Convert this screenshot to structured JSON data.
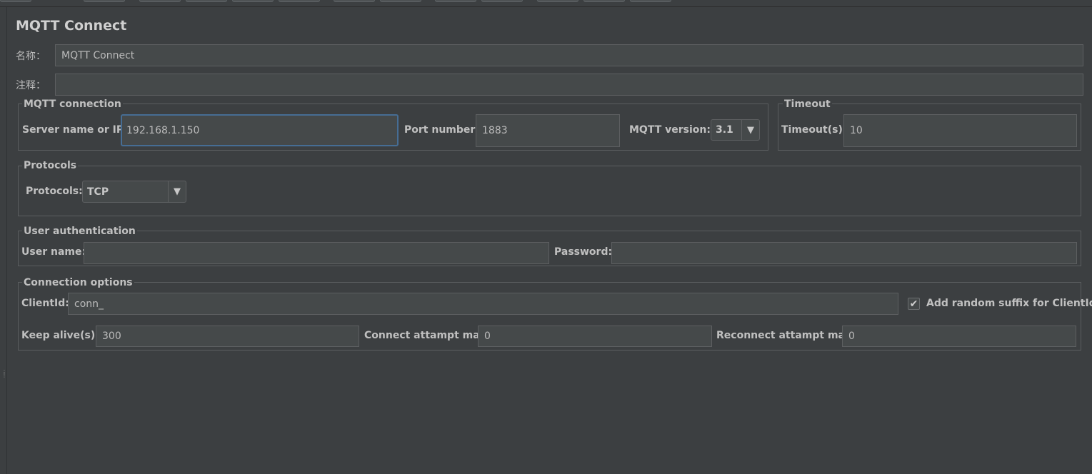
{
  "title": "MQTT Connect",
  "name_row": {
    "label": "名称：",
    "value": "MQTT Connect"
  },
  "comment_row": {
    "label": "注释：",
    "value": ""
  },
  "mqtt_connection": {
    "legend": "MQTT connection",
    "server_label": "Server name or IP:",
    "server_value": "192.168.1.150",
    "port_label": "Port number:",
    "port_value": "1883",
    "version_label": "MQTT version:",
    "version_value": "3.1"
  },
  "timeout": {
    "legend": "Timeout",
    "label": "Timeout(s):",
    "value": "10"
  },
  "protocols": {
    "legend": "Protocols",
    "label": "Protocols:",
    "value": "TCP"
  },
  "user_auth": {
    "legend": "User authentication",
    "user_label": "User name:",
    "user_value": "",
    "password_label": "Password:",
    "password_value": ""
  },
  "connection_options": {
    "legend": "Connection options",
    "clientid_label": "ClientId:",
    "clientid_value": "conn_",
    "random_suffix_label": "Add random suffix for ClientId",
    "random_suffix_checked": true,
    "keepalive_label": "Keep alive(s):",
    "keepalive_value": "300",
    "connect_max_label": "Connect attampt max:",
    "connect_max_value": "0",
    "reconnect_max_label": "Reconnect attampt max:",
    "reconnect_max_value": "0"
  },
  "icons": {
    "dropdown_arrow": "chevron-down-icon",
    "check": "checkmark-icon",
    "splitter": "splitter-grip-icon"
  },
  "colors": {
    "background": "#3c3f41",
    "field": "#45494a",
    "border": "#5d5f61",
    "focus": "#466d94",
    "text": "#bbbbbb"
  }
}
